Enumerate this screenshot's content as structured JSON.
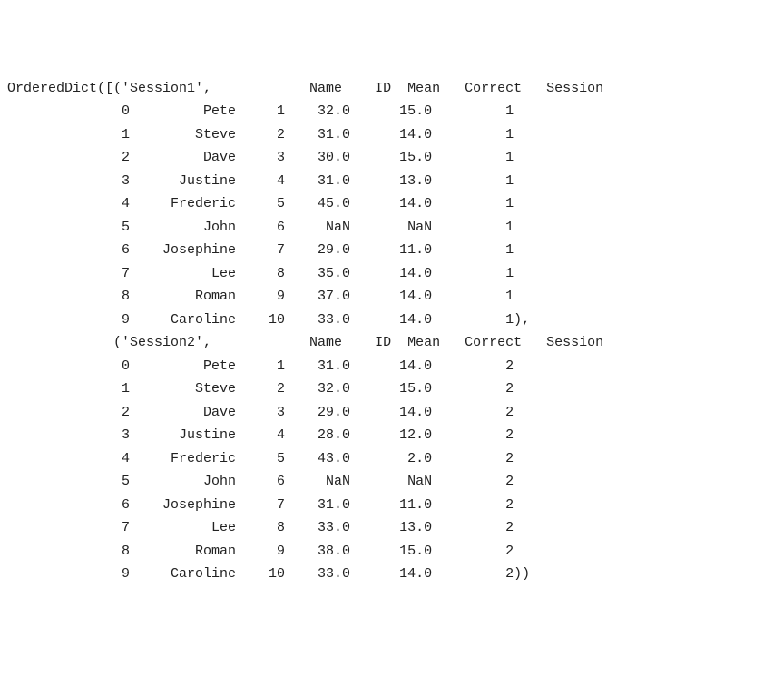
{
  "wrapper_open": "OrderedDict([",
  "wrapper_close": "])",
  "sessions": [
    {
      "key": "'Session1'",
      "columns": [
        "Name",
        "ID",
        "Mean",
        "Correct",
        "Session"
      ],
      "rows": [
        {
          "idx": "0",
          "name": "Pete",
          "id": "1",
          "mean": "32.0",
          "correct": "15.0",
          "session": "1"
        },
        {
          "idx": "1",
          "name": "Steve",
          "id": "2",
          "mean": "31.0",
          "correct": "14.0",
          "session": "1"
        },
        {
          "idx": "2",
          "name": "Dave",
          "id": "3",
          "mean": "30.0",
          "correct": "15.0",
          "session": "1"
        },
        {
          "idx": "3",
          "name": "Justine",
          "id": "4",
          "mean": "31.0",
          "correct": "13.0",
          "session": "1"
        },
        {
          "idx": "4",
          "name": "Frederic",
          "id": "5",
          "mean": "45.0",
          "correct": "14.0",
          "session": "1"
        },
        {
          "idx": "5",
          "name": "John",
          "id": "6",
          "mean": "NaN",
          "correct": "NaN",
          "session": "1"
        },
        {
          "idx": "6",
          "name": "Josephine",
          "id": "7",
          "mean": "29.0",
          "correct": "11.0",
          "session": "1"
        },
        {
          "idx": "7",
          "name": "Lee",
          "id": "8",
          "mean": "35.0",
          "correct": "14.0",
          "session": "1"
        },
        {
          "idx": "8",
          "name": "Roman",
          "id": "9",
          "mean": "37.0",
          "correct": "14.0",
          "session": "1"
        },
        {
          "idx": "9",
          "name": "Caroline",
          "id": "10",
          "mean": "33.0",
          "correct": "14.0",
          "session": "1"
        }
      ],
      "trailer": "),"
    },
    {
      "key": "'Session2'",
      "columns": [
        "Name",
        "ID",
        "Mean",
        "Correct",
        "Session"
      ],
      "rows": [
        {
          "idx": "0",
          "name": "Pete",
          "id": "1",
          "mean": "31.0",
          "correct": "14.0",
          "session": "2"
        },
        {
          "idx": "1",
          "name": "Steve",
          "id": "2",
          "mean": "32.0",
          "correct": "15.0",
          "session": "2"
        },
        {
          "idx": "2",
          "name": "Dave",
          "id": "3",
          "mean": "29.0",
          "correct": "14.0",
          "session": "2"
        },
        {
          "idx": "3",
          "name": "Justine",
          "id": "4",
          "mean": "28.0",
          "correct": "12.0",
          "session": "2"
        },
        {
          "idx": "4",
          "name": "Frederic",
          "id": "5",
          "mean": "43.0",
          "correct": "2.0",
          "session": "2"
        },
        {
          "idx": "5",
          "name": "John",
          "id": "6",
          "mean": "NaN",
          "correct": "NaN",
          "session": "2"
        },
        {
          "idx": "6",
          "name": "Josephine",
          "id": "7",
          "mean": "31.0",
          "correct": "11.0",
          "session": "2"
        },
        {
          "idx": "7",
          "name": "Lee",
          "id": "8",
          "mean": "33.0",
          "correct": "13.0",
          "session": "2"
        },
        {
          "idx": "8",
          "name": "Roman",
          "id": "9",
          "mean": "38.0",
          "correct": "15.0",
          "session": "2"
        },
        {
          "idx": "9",
          "name": "Caroline",
          "id": "10",
          "mean": "33.0",
          "correct": "14.0",
          "session": "2"
        }
      ],
      "trailer": ")"
    }
  ]
}
